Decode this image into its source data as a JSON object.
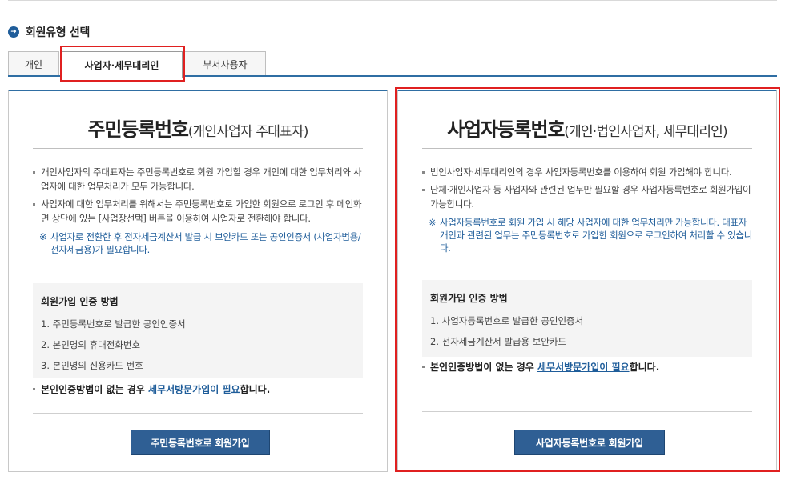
{
  "section": {
    "title": "회원유형 선택"
  },
  "tabs": [
    {
      "label": "개인"
    },
    {
      "label": "사업자·세무대리인"
    },
    {
      "label": "부서사용자"
    }
  ],
  "left_panel": {
    "heading_main": "주민등록번호",
    "heading_sub": "(개인사업자 주대표자)",
    "items": [
      "개인사업자의 주대표자는 주민등록번호로 회원 가입할 경우 개인에 대한 업무처리와 사업자에 대한 업무처리가 모두 가능합니다.",
      "사업자에 대한 업무처리를 위해서는 주민등록번호로 가입한 회원으로 로그인 후 메인화면 상단에 있는 [사업장선택] 버튼을 이용하여 사업자로 전환해야 합니다."
    ],
    "note_mark": "※",
    "note": "사업자로 전환한 후 전자세금계산서 발급 시 보안카드 또는 공인인증서 (사업자범용/전자세금용)가 필요합니다.",
    "auth_title": "회원가입 인증 방법",
    "auth_steps": [
      "1. 주민등록번호로 발급한 공인인증서",
      "2. 본인명의 휴대전화번호",
      "3. 본인명의 신용카드 번호"
    ],
    "foot_prefix": "본인인증방법이 없는 경우 ",
    "foot_link": "세무서방문가입이 필요",
    "foot_suffix": "합니다.",
    "button_label": "주민등록번호로 회원가입"
  },
  "right_panel": {
    "heading_main": "사업자등록번호",
    "heading_sub": "(개인·법인사업자, 세무대리인)",
    "items": [
      "법인사업자·세무대리인의 경우 사업자등록번호를 이용하여 회원 가입해야 합니다.",
      "단체·개인사업자 등 사업자와 관련된 업무만 필요할 경우 사업자등록번호로 회원가입이 가능합니다."
    ],
    "note_mark": "※",
    "note": "사업자등록번호로 회원 가입 시 해당 사업자에 대한 업무처리만 가능합니다. 대표자 개인과 관련된 업무는 주민등록번호로 가입한 회원으로 로그인하여 처리할 수 있습니다.",
    "auth_title": "회원가입 인증 방법",
    "auth_steps": [
      "1. 사업자등록번호로 발급한 공인인증서",
      "2. 전자세금계산서 발급용 보안카드"
    ],
    "foot_prefix": "본인인증방법이 없는 경우 ",
    "foot_link": "세무서방문가입이 필요",
    "foot_suffix": "합니다.",
    "button_label": "사업자등록번호로 회원가입"
  },
  "colors": {
    "accent": "#2f6ea3",
    "button": "#2f5f94",
    "note": "#1f5d9a",
    "highlight": "#e02020"
  }
}
